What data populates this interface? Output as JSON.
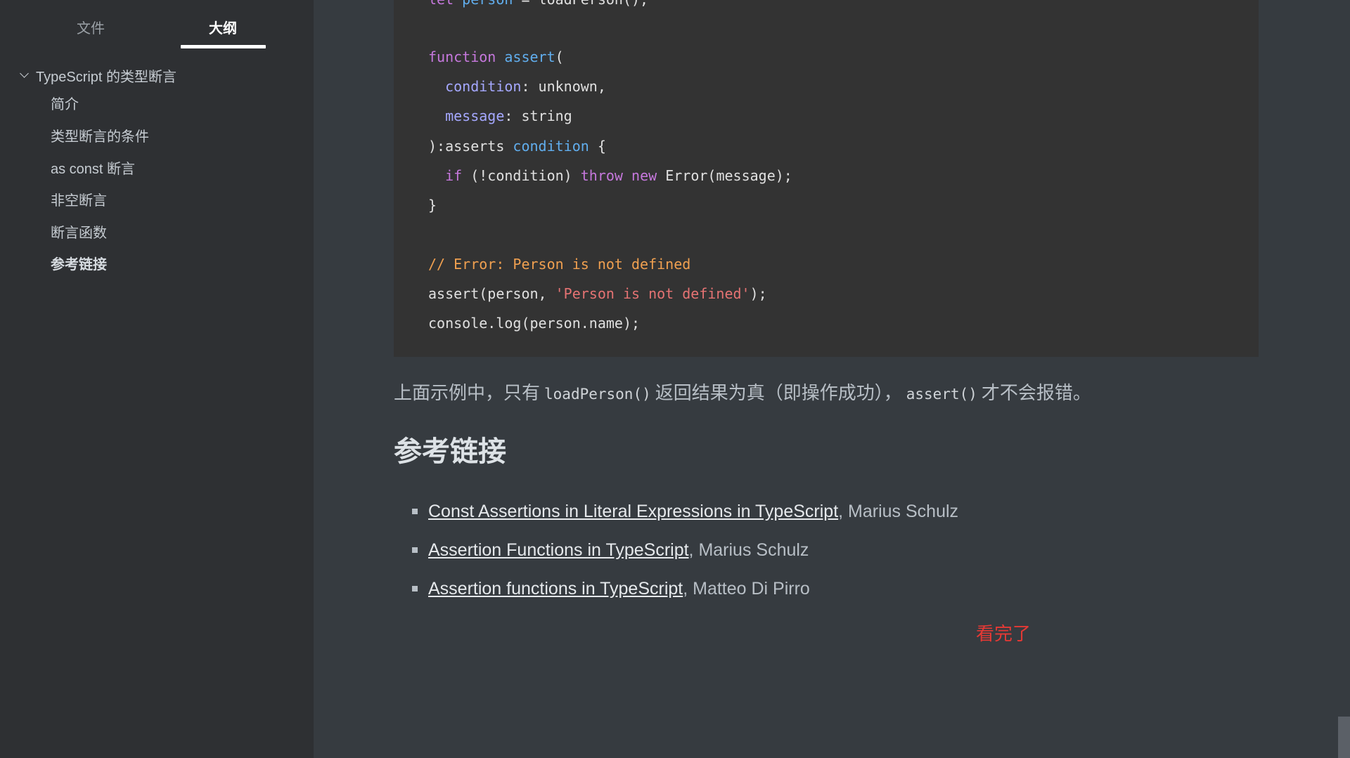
{
  "sidebar": {
    "tabs": {
      "files": "文件",
      "outline": "大纲"
    },
    "outline": {
      "root": "TypeScript 的类型断言",
      "items": [
        "简介",
        "类型断言的条件",
        "as const 断言",
        "非空断言",
        "断言函数",
        "参考链接"
      ],
      "active_index": 5
    }
  },
  "code": {
    "l1": {
      "kw": "let",
      "var": "person",
      "rest": " = loadPerson();"
    },
    "l2": {
      "kw": "function",
      "fn": "assert",
      "rest": "("
    },
    "l3": {
      "prop": "condition",
      "rest": ": unknown,"
    },
    "l4": {
      "prop": "message",
      "rest": ": string"
    },
    "l5": {
      "pre": "):asserts ",
      "param": "condition",
      "rest": " {"
    },
    "l6": {
      "kw1": "if",
      "mid1": " (!condition) ",
      "kw2": "throw",
      "sp": " ",
      "kw3": "new",
      "rest": " Error(message);"
    },
    "l7": "}",
    "l8": "// Error: Person is not defined",
    "l9": {
      "pre": "assert(person, ",
      "str": "'Person is not defined'",
      "rest": ");"
    },
    "l10": "console.log(person.name);"
  },
  "prose": {
    "part1": "上面示例中，只有",
    "code1": "loadPerson()",
    "part2": "返回结果为真（即操作成功），",
    "code2": "assert()",
    "part3": "才不会报错。"
  },
  "heading": "参考链接",
  "references": [
    {
      "link": "Const Assertions in Literal Expressions in TypeScript",
      "author": ", Marius Schulz"
    },
    {
      "link": "Assertion Functions in TypeScript",
      "author": ", Marius Schulz"
    },
    {
      "link": "Assertion functions in TypeScript",
      "author": ", Matteo Di Pirro"
    }
  ],
  "done_label": "看完了",
  "colors": {
    "background": "#363b40",
    "sidebar": "#2e3033",
    "code_bg": "#333333",
    "done": "#e53935"
  }
}
